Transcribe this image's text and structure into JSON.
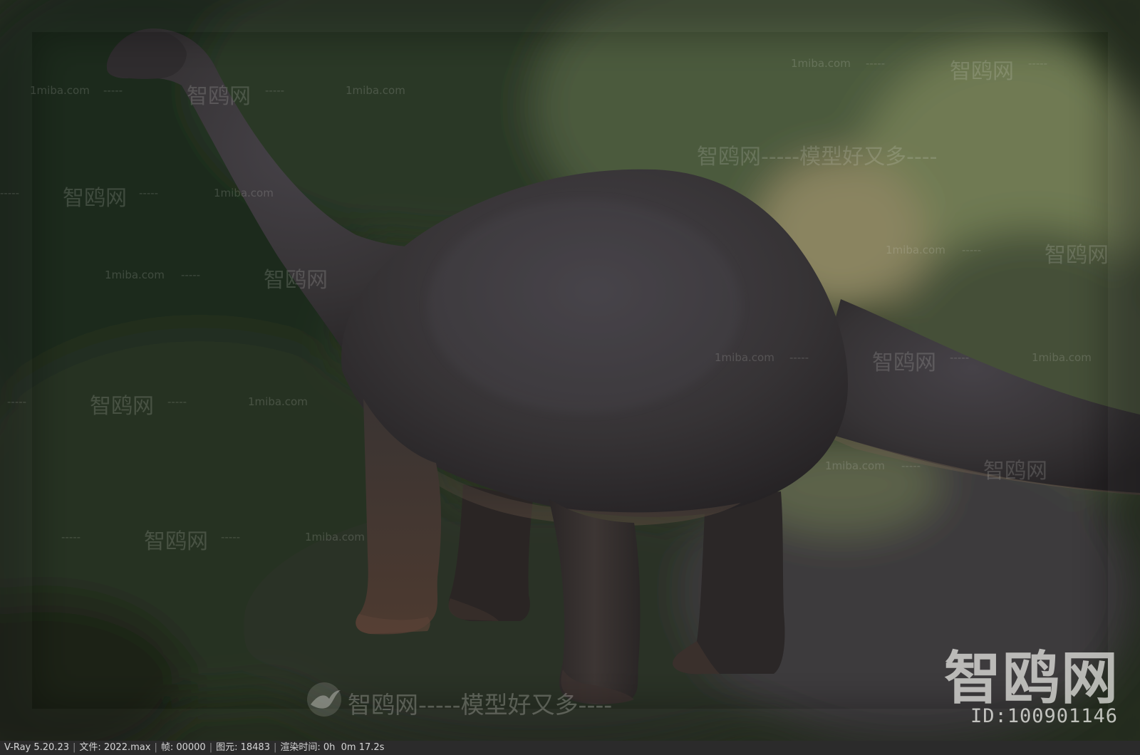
{
  "image": {
    "subject": "sauropod dinosaur 3D render",
    "colors": {
      "background_foliage": "#2f3b28",
      "dinosaur_body": "#3a3838",
      "status_bar": "#2b2b2b"
    }
  },
  "watermarks": {
    "site": "1miba.com",
    "brand": "智鸥网",
    "dashes": "-----",
    "slogan": "模型好又多",
    "line_full": "智鸥网-----模型好又多----",
    "bottom_slogan": "智鸥网-----模型好又多----"
  },
  "brand_block": {
    "name": "智鸥网",
    "id_text": "ID:100901146"
  },
  "status_bar": {
    "renderer": "V-Ray 5.20.23",
    "file": "文件: 2022.max",
    "frame": "帧: 00000",
    "primitives": "图元: 18483",
    "render_time": "渲染时间: 0h  0m 17.2s"
  }
}
